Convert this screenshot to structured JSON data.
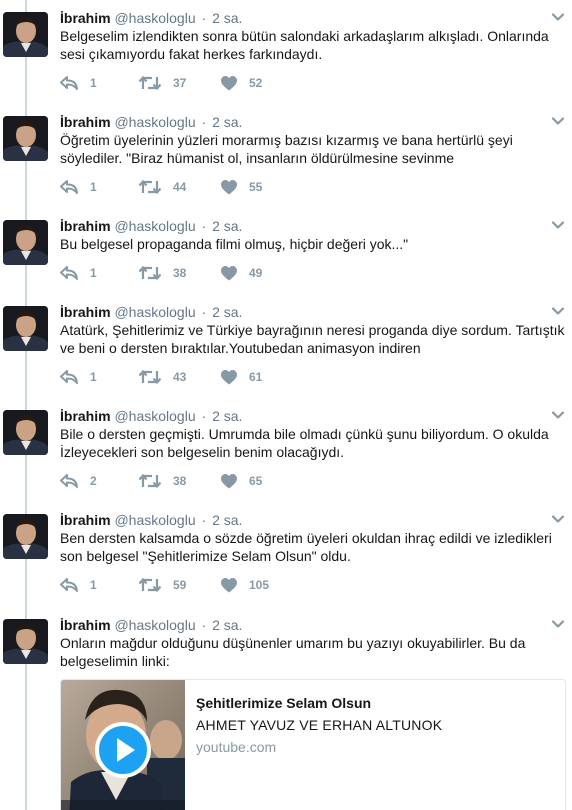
{
  "tweets": [
    {
      "name": "İbrahim",
      "handle": "@haskologlu",
      "time": "2 sa.",
      "text": "Belgeselim izlendikten sonra bütün salondaki arkadaşlarım alkışladı. Onlarında sesi çıkamıyordu fakat herkes farkındaydı.",
      "replies": "1",
      "retweets": "37",
      "likes": "52"
    },
    {
      "name": "İbrahim",
      "handle": "@haskologlu",
      "time": "2 sa.",
      "text": "Öğretim üyelerinin yüzleri morarmış bazısı kızarmış ve bana hertürlü şeyi söylediler. \"Biraz hümanist ol, insanların öldürülmesine sevinme",
      "replies": "1",
      "retweets": "44",
      "likes": "55"
    },
    {
      "name": "İbrahim",
      "handle": "@haskologlu",
      "time": "2 sa.",
      "text": "Bu belgesel propaganda filmi olmuş, hiçbir değeri yok...\"",
      "replies": "1",
      "retweets": "38",
      "likes": "49"
    },
    {
      "name": "İbrahim",
      "handle": "@haskologlu",
      "time": "2 sa.",
      "text": "Atatürk, Şehitlerimiz ve Türkiye bayrağının neresi proganda diye sordum. Tartıştık ve beni o dersten bıraktılar.Youtubedan animasyon indiren",
      "replies": "1",
      "retweets": "43",
      "likes": "61"
    },
    {
      "name": "İbrahim",
      "handle": "@haskologlu",
      "time": "2 sa.",
      "text": "Bile o dersten geçmişti. Umrumda bile olmadı çünkü şunu biliyordum. O okulda İzleyecekleri son belgeselin benim olacağıydı.",
      "replies": "2",
      "retweets": "38",
      "likes": "65"
    },
    {
      "name": "İbrahim",
      "handle": "@haskologlu",
      "time": "2 sa.",
      "text": "Ben dersten kalsamda o sözde öğretim üyeleri okuldan ihraç edildi ve izledikleri son belgesel \"Şehitlerimize Selam Olsun\" oldu.",
      "replies": "1",
      "retweets": "59",
      "likes": "105"
    },
    {
      "name": "İbrahim",
      "handle": "@haskologlu",
      "time": "2 sa.",
      "text": "Onların mağdur olduğunu düşünenler umarım bu yazıyı okuyabilirler. Bu da belgeselimin linki:",
      "card": {
        "title": "Şehitlerimize Selam Olsun",
        "description": "AHMET YAVUZ VE ERHAN ALTUNOK",
        "domain": "youtube.com"
      }
    }
  ],
  "icons": {
    "reply": "reply-icon",
    "retweet": "retweet-icon",
    "like": "heart-icon",
    "menu": "chevron-down-icon",
    "play": "play-icon"
  },
  "colors": {
    "icon": "#8899a6",
    "text": "#14171a",
    "muted": "#657786",
    "thread": "#ccd6dd",
    "border": "#e1e8ed",
    "play": "#1da1f2"
  }
}
